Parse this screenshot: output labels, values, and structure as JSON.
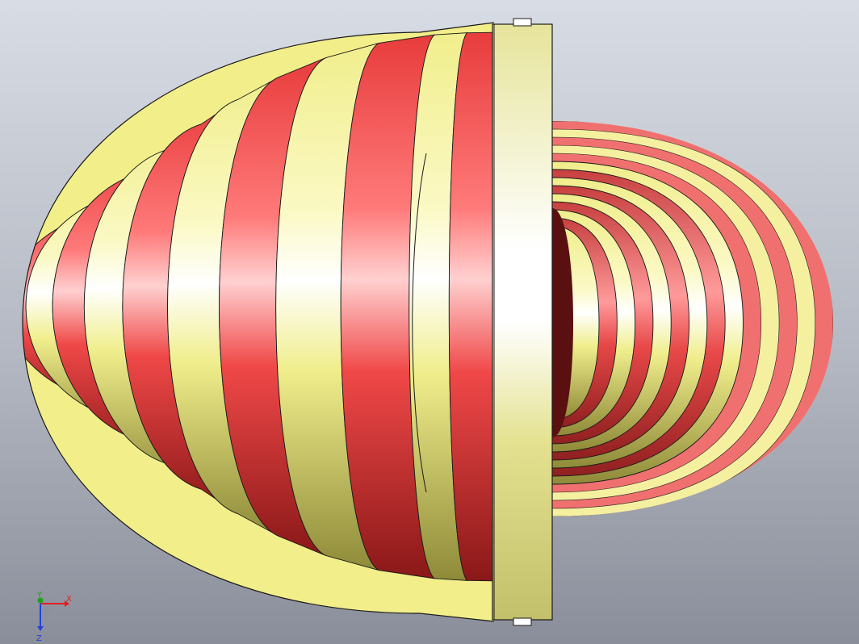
{
  "viewport": {
    "background_top": "#d4d8e0",
    "background_bottom": "#8c909c",
    "model": {
      "name": "spiral-coil-assembly",
      "stripe_colors": [
        "#ef4a4a",
        "#f2f088"
      ],
      "flange_color": "#e8e8a0",
      "edge_color": "#1a1a1a"
    }
  },
  "triad": {
    "x_label": "X",
    "y_label": "Y",
    "z_label": "Z",
    "x_color": "#e02020",
    "y_color": "#20a020",
    "z_color": "#2040e0"
  }
}
